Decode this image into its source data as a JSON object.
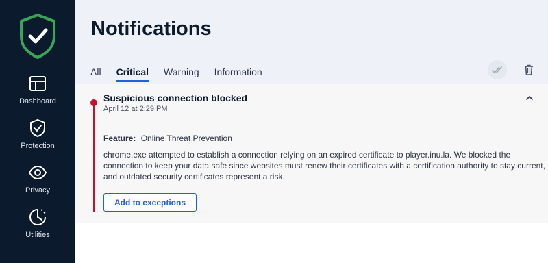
{
  "sidebar": {
    "logo_icon": "shield-check-icon",
    "items": [
      {
        "label": "Dashboard",
        "icon": "dashboard-icon"
      },
      {
        "label": "Protection",
        "icon": "shield-icon"
      },
      {
        "label": "Privacy",
        "icon": "eye-icon"
      },
      {
        "label": "Utilities",
        "icon": "utilities-icon"
      }
    ]
  },
  "header": {
    "title": "Notifications",
    "tabs": [
      {
        "label": "All"
      },
      {
        "label": "Critical"
      },
      {
        "label": "Warning"
      },
      {
        "label": "Information"
      }
    ],
    "active_tab": "Critical",
    "actions": [
      "mark-all-read-icon",
      "trash-icon"
    ]
  },
  "notification": {
    "title": "Suspicious connection blocked",
    "date": "April 12 at 2:29 PM",
    "feature_label": "Feature:",
    "feature_value": "Online Threat Prevention",
    "description": "chrome.exe attempted to establish a connection relying on an expired certificate to player.inu.la. We blocked the connection to keep your data safe since websites must renew their certificates with a certification authority to stay current, and outdated security certificates represent a risk.",
    "action_label": "Add to exceptions",
    "severity_color": "#c8102e"
  },
  "colors": {
    "sidebar_bg": "#0c1a2e",
    "accent": "#1f63d6",
    "logo_green": "#3aa655"
  }
}
